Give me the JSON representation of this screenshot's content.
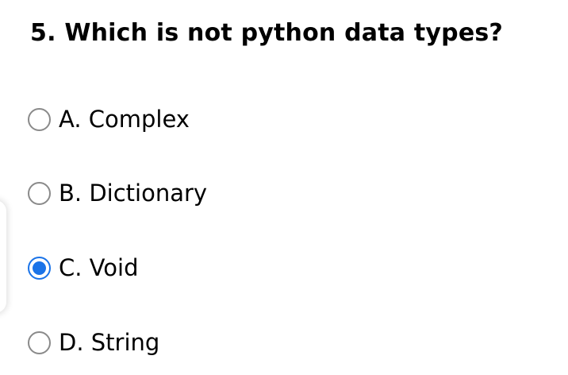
{
  "question": {
    "text": "5. Which is not python data types?"
  },
  "options": [
    {
      "label": "A. Complex",
      "checked": false
    },
    {
      "label": "B. Dictionary",
      "checked": false
    },
    {
      "label": "C. Void",
      "checked": true
    },
    {
      "label": "D. String",
      "checked": false
    }
  ],
  "colors": {
    "accent": "#1a73e8",
    "radio_border": "#8a8a8a"
  }
}
